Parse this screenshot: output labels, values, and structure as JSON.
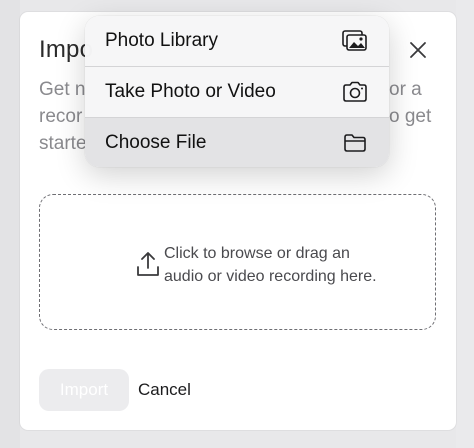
{
  "modal": {
    "title": "Impo",
    "description_lines": [
      "Get n",
      "recor",
      "starte"
    ],
    "description_tail": [
      "or a",
      "o get"
    ],
    "dropzone_text": "Click to browse or drag an audio or video recording here.",
    "import_label": "Import",
    "cancel_label": "Cancel"
  },
  "menu": {
    "items": [
      {
        "label": "Photo Library",
        "icon": "photo-library-icon"
      },
      {
        "label": "Take Photo or Video",
        "icon": "camera-icon"
      },
      {
        "label": "Choose File",
        "icon": "folder-icon"
      }
    ],
    "highlighted_index": 2
  }
}
